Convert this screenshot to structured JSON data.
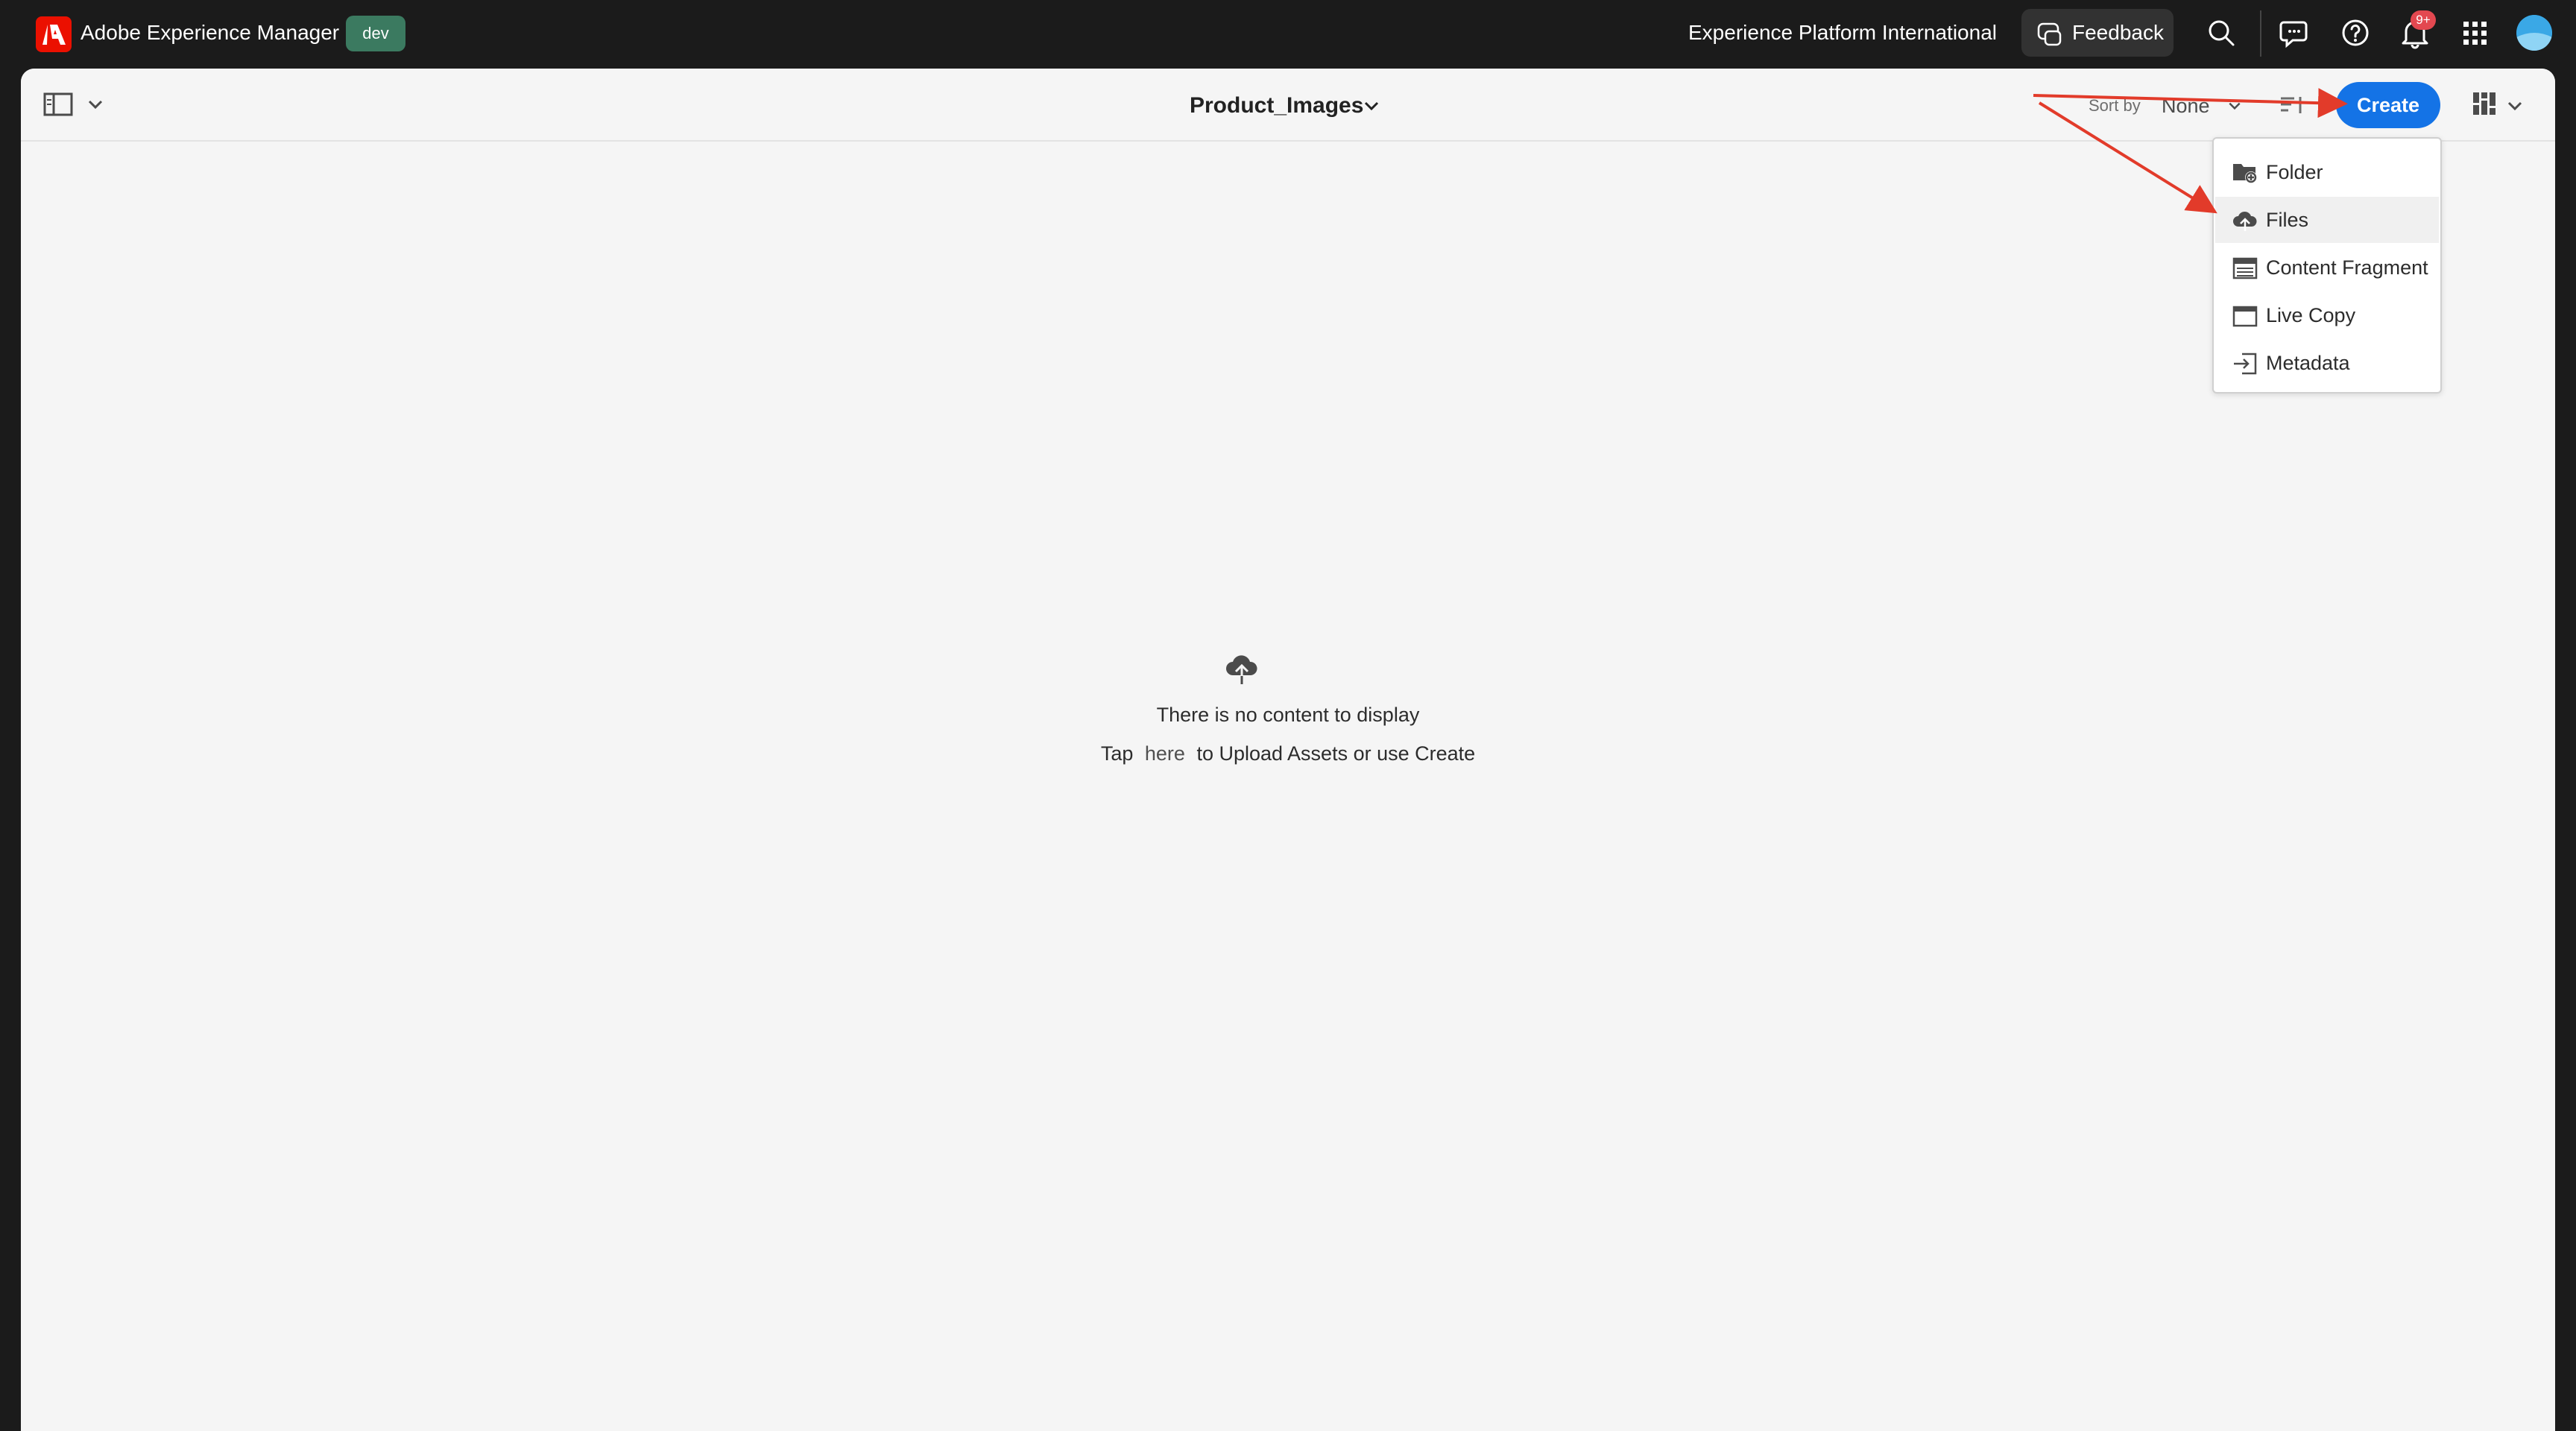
{
  "header": {
    "app_title": "Adobe Experience Manager",
    "env_badge": "dev",
    "org_name": "Experience Platform International",
    "feedback_label": "Feedback",
    "notification_badge": "9+",
    "icons": [
      "search-icon",
      "chat-icon",
      "help-icon",
      "bell-icon",
      "apps-grid-icon"
    ]
  },
  "actionbar": {
    "folder_title": "Product_Images",
    "sort_label": "Sort by",
    "sort_value": "None",
    "create_label": "Create"
  },
  "create_menu": {
    "items": [
      {
        "label": "Folder",
        "icon": "folder-add-icon"
      },
      {
        "label": "Files",
        "icon": "cloud-upload-icon"
      },
      {
        "label": "Content Fragment",
        "icon": "content-fragment-icon"
      },
      {
        "label": "Live Copy",
        "icon": "live-copy-icon"
      },
      {
        "label": "Metadata",
        "icon": "import-icon"
      }
    ],
    "highlighted": "Files"
  },
  "empty_state": {
    "title": "There is no content to display",
    "hint_prefix": "Tap",
    "hint_link": "here",
    "hint_suffix": "to Upload Assets or use Create"
  },
  "colors": {
    "accent": "#1473e6",
    "topbar_bg": "#1b1b1b",
    "panel_bg": "#f5f5f5",
    "badge_green": "#3b7a60",
    "annotation_red": "#e23b2a"
  }
}
